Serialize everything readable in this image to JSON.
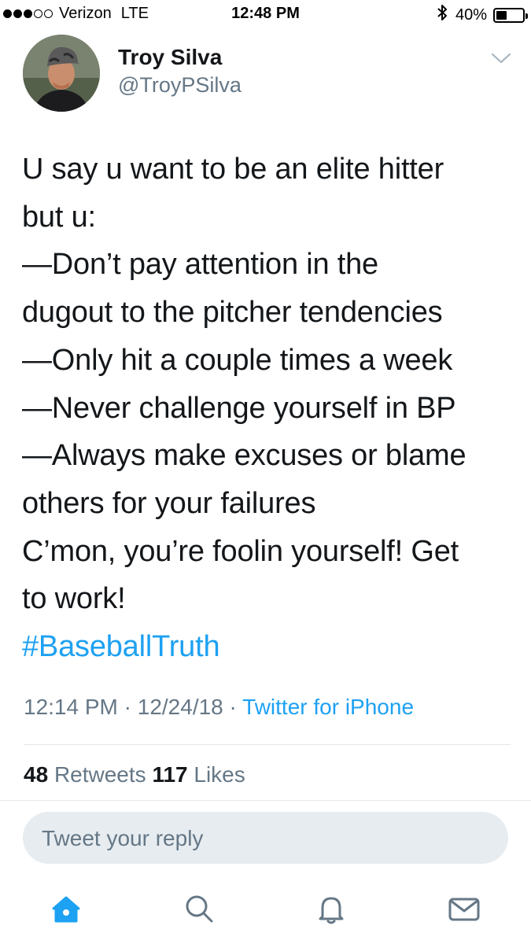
{
  "status_bar": {
    "carrier": "Verizon",
    "network": "LTE",
    "time": "12:48 PM",
    "battery": "40%",
    "battery_level": 0.4,
    "bluetooth_icon": "bluetooth-icon",
    "signal_bars_filled": 3,
    "signal_bars_total": 5
  },
  "tweet": {
    "author_name": "Troy Silva",
    "author_handle": "@TroyPSilva",
    "lines": [
      "U say u want to be an elite hitter",
      "but u:",
      "—Don’t pay attention in the",
      "dugout to the pitcher tendencies",
      "—Only hit a couple times a week",
      "—Never challenge yourself in BP",
      "—Always make excuses or blame",
      "others for your failures",
      "C’mon, you’re foolin yourself! Get",
      "to work!"
    ],
    "hashtag": "#BaseballTruth",
    "time": "12:14 PM",
    "separator": "·",
    "date": "12/24/18",
    "source": "Twitter for iPhone"
  },
  "stats": {
    "retweets_count": "48",
    "retweets_label": "Retweets",
    "likes_count": "117",
    "likes_label": "Likes"
  },
  "reply": {
    "placeholder": "Tweet your reply"
  },
  "tab_bar": {
    "tabs": [
      "home-icon",
      "search-icon",
      "notifications-icon",
      "messages-icon"
    ],
    "active_tab": "home-icon"
  },
  "colors": {
    "accent": "#1da1f2",
    "text_primary": "#14171a",
    "text_secondary": "#657786",
    "reply_bg": "#e6ecf0",
    "divider": "#e1e8ed"
  }
}
